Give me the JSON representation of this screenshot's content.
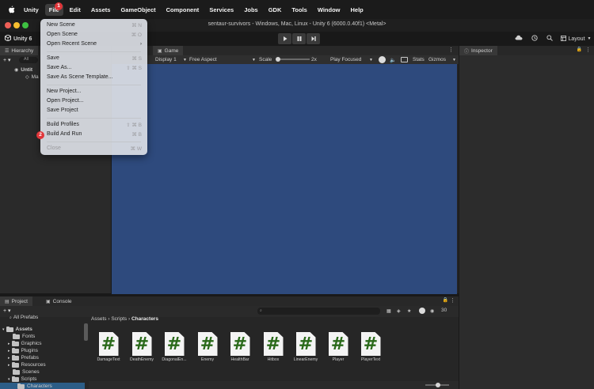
{
  "menubar": {
    "apple": "",
    "items": [
      "Unity",
      "File",
      "Edit",
      "Assets",
      "GameObject",
      "Component",
      "Services",
      "Jobs",
      "GDK",
      "Tools",
      "Window",
      "Help"
    ],
    "file_badge": "1"
  },
  "window": {
    "title": "sentaur-survivors - Windows, Mac, Linux - Unity 6 (6000.0.40f1) <Metal>"
  },
  "toolbar": {
    "account": "Unity 6",
    "layout": "Layout"
  },
  "file_menu": {
    "items": [
      {
        "label": "New Scene",
        "shortcut": "⌘ N"
      },
      {
        "label": "Open Scene",
        "shortcut": "⌘ O"
      },
      {
        "label": "Open Recent Scene",
        "shortcut": "›"
      },
      {
        "label": "Save",
        "shortcut": "⌘ S"
      },
      {
        "label": "Save As...",
        "shortcut": "⇧ ⌘ S"
      },
      {
        "label": "Save As Scene Template...",
        "shortcut": ""
      },
      {
        "label": "New Project...",
        "shortcut": ""
      },
      {
        "label": "Open Project...",
        "shortcut": ""
      },
      {
        "label": "Save Project",
        "shortcut": ""
      },
      {
        "label": "Build Profiles",
        "shortcut": "⇧ ⌘ B"
      },
      {
        "label": "Build And Run",
        "shortcut": "⌘ B"
      },
      {
        "label": "Close",
        "shortcut": "⌘ W"
      }
    ],
    "badge": "2"
  },
  "hierarchy": {
    "tab": "Hierarchy",
    "add": "+ ▾",
    "search_placeholder": "All",
    "items": [
      "Untit",
      "Ma"
    ]
  },
  "game": {
    "tab": "Game",
    "display": "Display 1",
    "aspect": "Free Aspect",
    "scale_label": "Scale",
    "scale_value": "2x",
    "play_mode": "Play Focused",
    "stats": "Stats",
    "gizmos": "Gizmos"
  },
  "inspector": {
    "tab": "Inspector"
  },
  "project": {
    "tabs": [
      "Project",
      "Console"
    ],
    "add": "+ ▾",
    "hidden_count": "30",
    "tree": [
      {
        "label": "All Prefabs",
        "indent": 0
      },
      {
        "label": "Assets",
        "indent": 0
      },
      {
        "label": "Fonts",
        "indent": 1
      },
      {
        "label": "Graphics",
        "indent": 1
      },
      {
        "label": "Plugins",
        "indent": 1
      },
      {
        "label": "Prefabs",
        "indent": 1
      },
      {
        "label": "Resources",
        "indent": 1
      },
      {
        "label": "Scenes",
        "indent": 1
      },
      {
        "label": "Scripts",
        "indent": 1
      },
      {
        "label": "Characters",
        "indent": 2
      }
    ],
    "breadcrumb": [
      "Assets",
      "Scripts",
      "Characters"
    ],
    "assets": [
      "DamageText",
      "DeathEnemy",
      "DiagonalEn...",
      "Enemy",
      "HealthBar",
      "Hitbox",
      "LinearEnemy",
      "Player",
      "PlayerText"
    ],
    "asset_glyph": "#"
  }
}
